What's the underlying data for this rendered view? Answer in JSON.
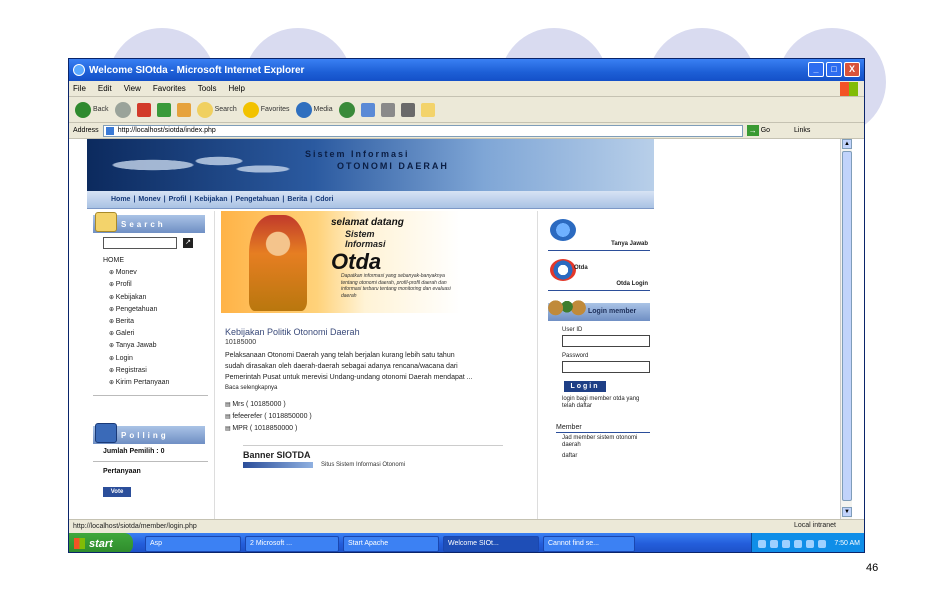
{
  "window": {
    "title": "Welcome SIOtda - Microsoft Internet Explorer",
    "buttons": {
      "minimize": "_",
      "maximize": "□",
      "close": "X"
    }
  },
  "menubar": [
    "File",
    "Edit",
    "View",
    "Favorites",
    "Tools",
    "Help"
  ],
  "toolbar": {
    "back": "Back",
    "search": "Search",
    "favorites": "Favorites",
    "media": "Media"
  },
  "addressbar": {
    "label": "Address",
    "url": "http://localhost/siotda/index.php",
    "go": "Go",
    "links": "Links"
  },
  "site": {
    "banner_line1": "Sistem Informasi",
    "banner_line2": "OTONOMI DAERAH",
    "nav": [
      "Home",
      "Monev",
      "Profil",
      "Kebijakan",
      "Pengetahuan",
      "Berita",
      "Cdori"
    ],
    "search_title": "Search",
    "menu": {
      "home": "HOME",
      "items": [
        "Monev",
        "Profil",
        "Kebijakan",
        "Pengetahuan",
        "Berita",
        "Galeri",
        "Tanya Jawab",
        "Login",
        "Registrasi",
        "Kirim Pertanyaan"
      ]
    },
    "polling_title": "Polling",
    "polling_count": "Jumlah Pemilih : 0",
    "pertanyaan": "Pertanyaan",
    "vote": "Vote",
    "welcome": {
      "line1": "selamat datang",
      "line2": "Sistem",
      "line3": "Informasi",
      "line4": "Otda",
      "desc": "Dapatkan informasi yang sebanyak-banyaknya tentang otonomi daerah, profil-profil daerah dan informasi terbaru tentang monitoring dan evaluasi daerah"
    },
    "article": {
      "title": "Kebijakan Politik Otonomi Daerah",
      "date": "10185000",
      "body": "Pelaksanaan Otonomi Daerah yang telah berjalan kurang lebih satu tahun sudah dirasakan oleh daerah-daerah sebagai adanya rencana/wacana dari Pemerintah Pusat untuk merevisi Undang-undang otonomi Daerah mendapat ...",
      "more": "Baca selengkapnya"
    },
    "links": [
      "Mrs ( 10185000 )",
      "fefeerefer ( 1018850000 )",
      "MPR ( 1018850000 )"
    ],
    "banner_title": "Banner SIOTDA",
    "banner_sub": "Situs Sistem Informasi Otonomi",
    "right": {
      "tanya_jawab": "Tanya Jawab",
      "otda": "Otda",
      "otda_login": "Otda Login",
      "login_member": "Login member",
      "user_id": "User ID",
      "password": "Password",
      "login_btn": "Login",
      "login_note": "login bagi member otda yang telah daftar",
      "member_head": "Member",
      "member_note": "Jad member sistem otonomi daerah",
      "daftar": "daftar"
    }
  },
  "statusbar": {
    "text": "http://localhost/siotda/member/login.php",
    "zone": "Local intranet"
  },
  "taskbar": {
    "start": "start",
    "items": [
      "Asp",
      "2 Microsoft ...",
      "Start Apache",
      "Welcome SIOt...",
      "Cannot find se..."
    ],
    "clock": "7:50 AM"
  },
  "slide_number": "46"
}
